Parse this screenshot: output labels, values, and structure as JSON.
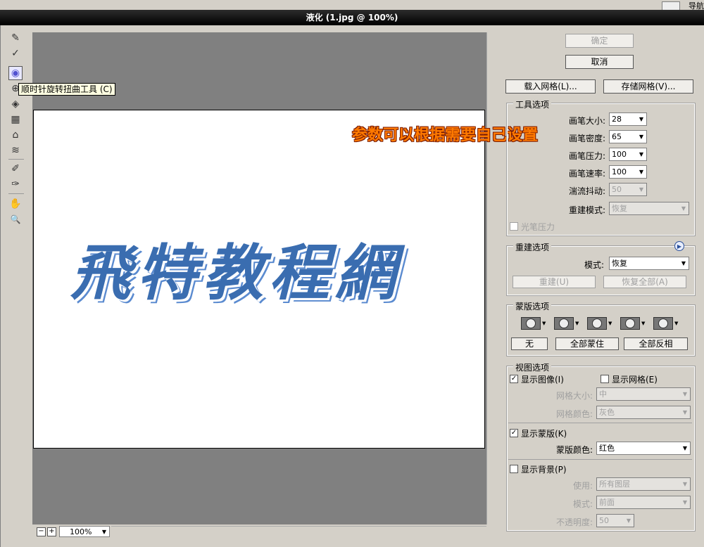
{
  "top": {
    "nav_label": "导航"
  },
  "window": {
    "title": "液化 (1.jpg @ 100%)"
  },
  "toolbar": {
    "tools": [
      {
        "name": "forward-warp-tool",
        "icon": "✎"
      },
      {
        "name": "reconstruct-tool",
        "icon": "✓"
      },
      {
        "name": "twirl-clockwise-tool",
        "icon": "◉"
      },
      {
        "name": "pucker-tool",
        "icon": "⊕"
      },
      {
        "name": "bloat-tool",
        "icon": "◈"
      },
      {
        "name": "push-left-tool",
        "icon": "▦"
      },
      {
        "name": "mirror-tool",
        "icon": "⌂"
      },
      {
        "name": "turbulence-tool",
        "icon": "≋"
      },
      {
        "name": "freeze-mask-tool",
        "icon": "✐"
      },
      {
        "name": "thaw-mask-tool",
        "icon": "✑"
      },
      {
        "name": "hand-tool",
        "icon": "✋"
      },
      {
        "name": "zoom-tool",
        "icon": "🔍"
      }
    ],
    "tooltip": "顺时针旋转扭曲工具 (C)"
  },
  "canvas": {
    "image_text": "飛特教程網",
    "annotation": "参数可以根据需要自己设置"
  },
  "zoom": {
    "minus": "−",
    "plus": "+",
    "value": "100%"
  },
  "buttons": {
    "ok": "确定",
    "cancel": "取消",
    "load_mesh": "载入网格(L)...",
    "save_mesh": "存储网格(V)..."
  },
  "tool_options": {
    "title": "工具选项",
    "brush_size_label": "画笔大小:",
    "brush_size": "28",
    "brush_density_label": "画笔密度:",
    "brush_density": "65",
    "brush_pressure_label": "画笔压力:",
    "brush_pressure": "100",
    "brush_rate_label": "画笔速率:",
    "brush_rate": "100",
    "turbulent_jitter_label": "湍流抖动:",
    "turbulent_jitter": "50",
    "reconstruct_mode_label": "重建模式:",
    "reconstruct_mode": "恢复",
    "stylus_pressure": "光笔压力"
  },
  "reconstruct_options": {
    "title": "重建选项",
    "mode_label": "模式:",
    "mode": "恢复",
    "reconstruct_btn": "重建(U)",
    "restore_all_btn": "恢复全部(A)"
  },
  "mask_options": {
    "title": "蒙版选项",
    "none_btn": "无",
    "mask_all_btn": "全部蒙住",
    "invert_all_btn": "全部反相"
  },
  "view_options": {
    "title": "视图选项",
    "show_image": "显示图像(I)",
    "show_mesh": "显示网格(E)",
    "mesh_size_label": "网格大小:",
    "mesh_size": "中",
    "mesh_color_label": "网格颜色:",
    "mesh_color": "灰色",
    "show_mask": "显示蒙版(K)",
    "mask_color_label": "蒙版颜色:",
    "mask_color": "红色",
    "show_backdrop": "显示背景(P)",
    "use_label": "使用:",
    "use": "所有图层",
    "mode_label": "模式:",
    "mode": "前面",
    "opacity_label": "不透明度:",
    "opacity": "50"
  },
  "colors": {
    "title_bar": "#1a1a1a",
    "canvas_bg": "#808080",
    "calligraphy": "#3a6db0",
    "annotation": "#ff7a00"
  }
}
